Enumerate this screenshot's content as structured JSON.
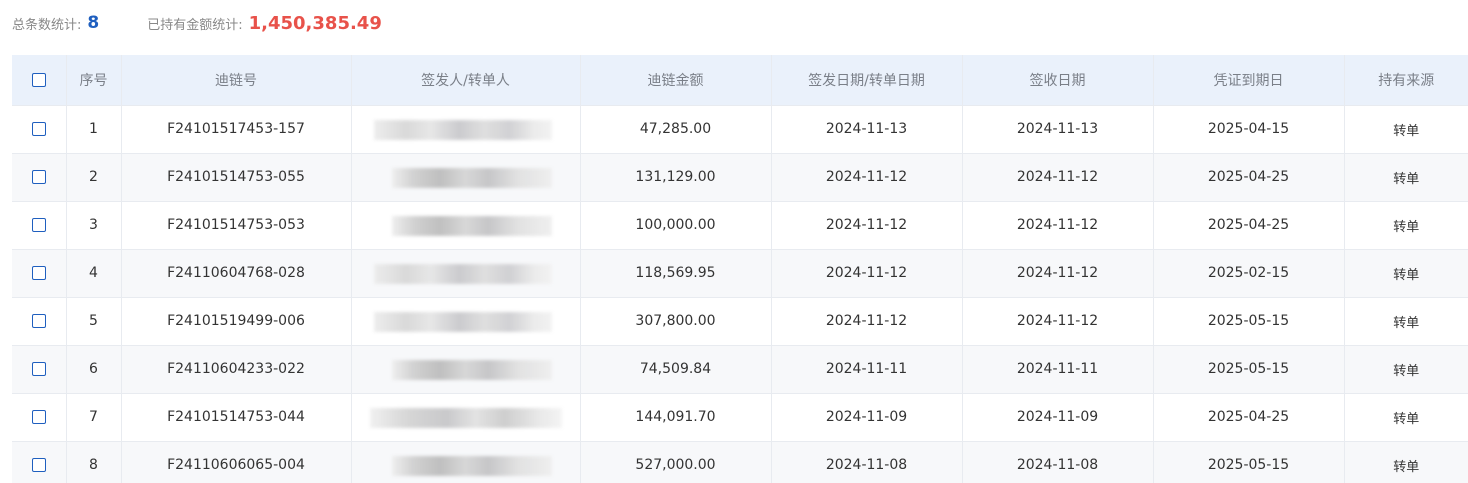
{
  "summary": {
    "count_label": "总条数统计:",
    "count_value": "8",
    "amount_label": "已持有金额统计:",
    "amount_value": "1,450,385.49"
  },
  "table": {
    "headers": [
      "序号",
      "迪链号",
      "签发人/转单人",
      "迪链金额",
      "签发日期/转单日期",
      "签收日期",
      "凭证到期日",
      "持有来源"
    ],
    "rows": [
      {
        "index": "1",
        "chain_no": "F24101517453-157",
        "amount": "47,285.00",
        "issue_date": "2024-11-13",
        "sign_date": "2024-11-13",
        "due_date": "2025-04-15",
        "source": "转单"
      },
      {
        "index": "2",
        "chain_no": "F24101514753-055",
        "amount": "131,129.00",
        "issue_date": "2024-11-12",
        "sign_date": "2024-11-12",
        "due_date": "2025-04-25",
        "source": "转单"
      },
      {
        "index": "3",
        "chain_no": "F24101514753-053",
        "amount": "100,000.00",
        "issue_date": "2024-11-12",
        "sign_date": "2024-11-12",
        "due_date": "2025-04-25",
        "source": "转单"
      },
      {
        "index": "4",
        "chain_no": "F24110604768-028",
        "amount": "118,569.95",
        "issue_date": "2024-11-12",
        "sign_date": "2024-11-12",
        "due_date": "2025-02-15",
        "source": "转单"
      },
      {
        "index": "5",
        "chain_no": "F24101519499-006",
        "amount": "307,800.00",
        "issue_date": "2024-11-12",
        "sign_date": "2024-11-12",
        "due_date": "2025-05-15",
        "source": "转单"
      },
      {
        "index": "6",
        "chain_no": "F24110604233-022",
        "amount": "74,509.84",
        "issue_date": "2024-11-11",
        "sign_date": "2024-11-11",
        "due_date": "2025-05-15",
        "source": "转单"
      },
      {
        "index": "7",
        "chain_no": "F24101514753-044",
        "amount": "144,091.70",
        "issue_date": "2024-11-09",
        "sign_date": "2024-11-09",
        "due_date": "2025-04-25",
        "source": "转单"
      },
      {
        "index": "8",
        "chain_no": "F24110606065-004",
        "amount": "527,000.00",
        "issue_date": "2024-11-08",
        "sign_date": "2024-11-08",
        "due_date": "2025-05-15",
        "source": "转单"
      }
    ]
  },
  "colors": {
    "accent_blue": "#1f5fbf",
    "amount_red": "#e8524a",
    "header_bg": "#eaf1fb"
  },
  "icons": {
    "checkbox": "checkbox-icon"
  }
}
